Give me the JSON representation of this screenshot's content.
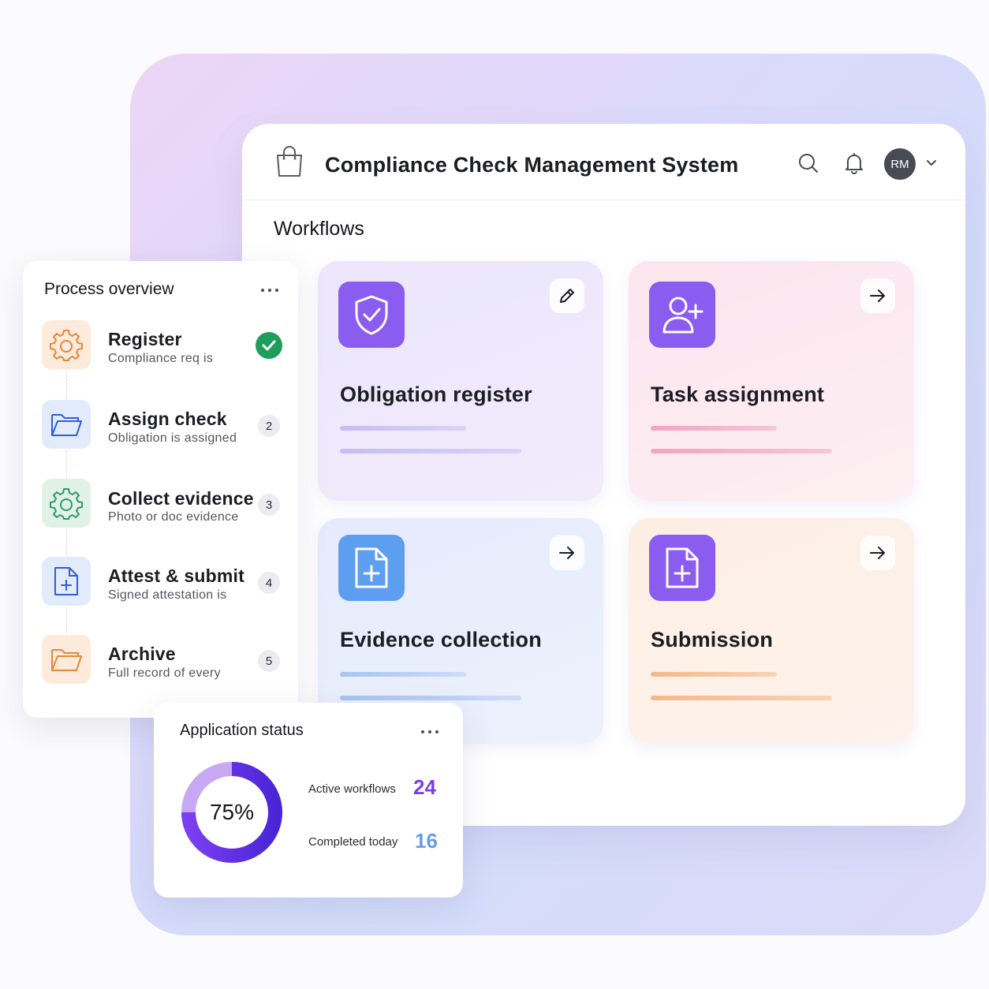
{
  "app": {
    "title": "Compliance Check Management System",
    "user_initials": "RM",
    "section_title": "Workflows"
  },
  "workflows": [
    {
      "title": "Obligation register",
      "icon": "shield-check-icon",
      "action_icon": "pencil-icon",
      "accent": "#8a5cf0"
    },
    {
      "title": "Task assignment",
      "icon": "add-user-icon",
      "action_icon": "arrow-right-icon",
      "accent": "#8a5cf0"
    },
    {
      "title": "Evidence collection",
      "icon": "file-plus-icon",
      "action_icon": "arrow-right-icon",
      "accent": "#5e9ef0"
    },
    {
      "title": "Submission",
      "icon": "file-plus-icon",
      "action_icon": "arrow-right-icon",
      "accent": "#8a5cf0"
    }
  ],
  "process_overview": {
    "title": "Process overview",
    "steps": [
      {
        "label": "Register",
        "desc": "Compliance req is",
        "status": "done",
        "icon": "gear-icon"
      },
      {
        "label": "Assign check",
        "desc": "Obligation is assigned",
        "badge": "2",
        "icon": "folder-icon"
      },
      {
        "label": "Collect evidence",
        "desc": "Photo or doc evidence",
        "badge": "3",
        "icon": "gear-icon"
      },
      {
        "label": "Attest & submit",
        "desc": "Signed attestation is",
        "badge": "4",
        "icon": "file-plus-icon"
      },
      {
        "label": "Archive",
        "desc": "Full record of every",
        "badge": "5",
        "icon": "folder-icon"
      }
    ]
  },
  "application_status": {
    "title": "Application status",
    "progress_label": "75%",
    "progress_value": 0.75,
    "stats": [
      {
        "label": "Active workflows",
        "value": "24",
        "color": "#7b3fe4"
      },
      {
        "label": "Completed today",
        "value": "16",
        "color": "#6a9be6"
      }
    ]
  },
  "colors": {
    "brand_purple": "#8a5cf0",
    "success_green": "#1f9d5b",
    "donut_dark": "#5a2ee0",
    "donut_light": "#c7a8f3"
  }
}
